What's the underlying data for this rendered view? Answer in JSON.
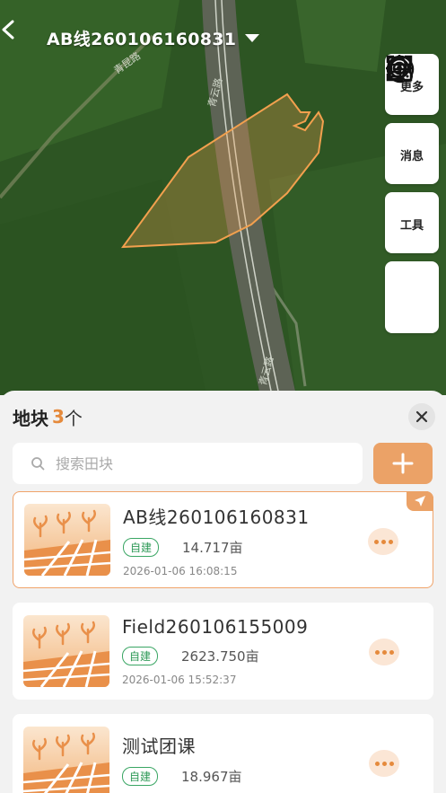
{
  "header": {
    "title": "AB线260106160831"
  },
  "map": {
    "road_labels": [
      "青昆路",
      "青云路",
      "青云路"
    ]
  },
  "tools": [
    {
      "label": "更多",
      "icon": "plus-circle-icon"
    },
    {
      "label": "消息",
      "icon": "bell-icon"
    },
    {
      "label": "工具",
      "icon": "toolbox-icon"
    }
  ],
  "panel": {
    "title": "地块",
    "count": "3",
    "unit": "个",
    "search_placeholder": "搜索田块"
  },
  "fields": [
    {
      "name": "AB线260106160831",
      "tag": "自建",
      "area": "14.717亩",
      "date": "2026-01-06 16:08:15",
      "active": true
    },
    {
      "name": "Field260106155009",
      "tag": "自建",
      "area": "2623.750亩",
      "date": "2026-01-06 15:52:37",
      "active": false
    },
    {
      "name": "测试团课",
      "tag": "自建",
      "area": "18.967亩",
      "date": "",
      "active": false
    }
  ],
  "colors": {
    "accent": "#eba267",
    "count": "#e58a3c",
    "tag_green": "#3aa664",
    "polygon": "#f2a04e"
  }
}
